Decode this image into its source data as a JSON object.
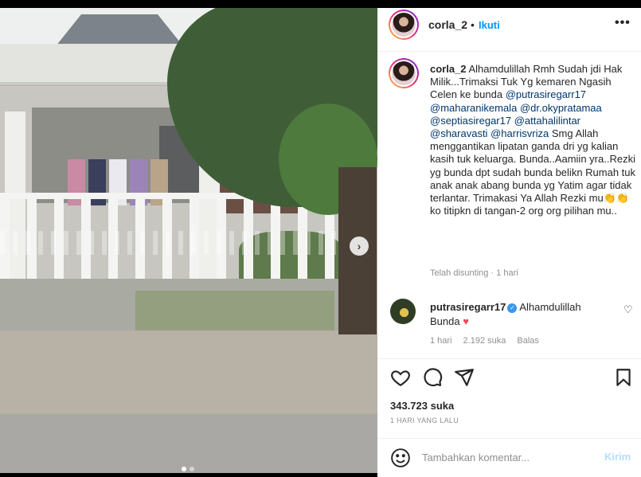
{
  "post": {
    "username": "corla_2",
    "separator": "•",
    "follow_label": "Ikuti",
    "more_label": "•••",
    "image_alt": "rumah",
    "carousel_next": "›",
    "carousel_count": 2,
    "carousel_active": 1
  },
  "caption": {
    "username": "corla_2",
    "text_1": " Alhamdulillah Rmh Sudah jdi Hak Milik...Trimaksi Tuk Yg kemaren Ngasih Celen ke bunda ",
    "mentions_1": [
      "@putrasiregarr17",
      "@maharanikemala",
      "@dr.okypratamaa",
      "@septiasiregar17",
      "@attahalilintar",
      "@sharavasti",
      "@harrisvriza"
    ],
    "text_2": " Smg Allah menggantikan lipatan ganda dri yg kalian kasih tuk keluarga. Bunda..Aamiin yra..Rezki yg bunda dpt sudah bunda belikn Rumah tuk anak anak abang bunda yg Yatim agar tidak terlantar. Trimakasi Ya Allah Rezki mu",
    "emoji": "👏👏",
    "text_3": " ko titipkn di tangan-2 org org pilihan mu..",
    "meta": "Telah disunting · 1 hari"
  },
  "comment": {
    "username": "putrasiregarr17",
    "verified_mark": "✓",
    "text": "Alhamdulillah Bunda",
    "heart": "♥",
    "like_icon": "♡",
    "time": "1 hari",
    "likes": "2.192 suka",
    "reply": "Balas"
  },
  "actions": {
    "icons": [
      "heart-icon",
      "comment-icon",
      "share-icon",
      "bookmark-icon"
    ],
    "likes": "343.723 suka",
    "date": "1 HARI YANG LALU"
  },
  "add_comment": {
    "placeholder": "Tambahkan komentar...",
    "post_label": "Kirim"
  },
  "colors": {
    "accent": "#0095f6",
    "mention": "#00376b",
    "muted": "#8e8e8e",
    "heart": "#ed4956",
    "post_disabled": "#b2dffc"
  }
}
